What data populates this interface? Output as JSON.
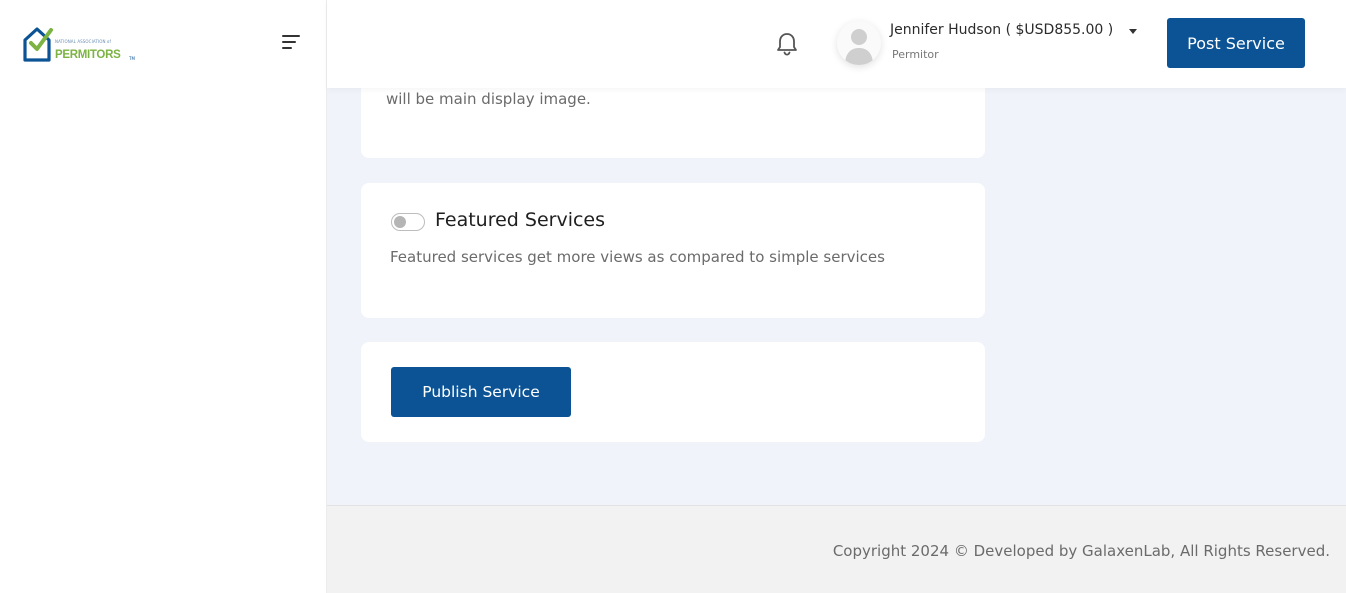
{
  "brand": {
    "logo_small_text": "NATIONAL ASSOCIATION of",
    "logo_main_text": "PERMITORS",
    "logo_tm": "TM",
    "colors": {
      "primary": "#0b5394",
      "accent": "#7cb342"
    }
  },
  "header": {
    "user_name": "Jennifer Hudson ( $USD855.00 )",
    "user_role": "Permitor",
    "post_button_label": "Post Service",
    "icons": [
      "menu-icon",
      "bell-icon",
      "avatar-icon",
      "caret-down-icon"
    ]
  },
  "cards": {
    "image_note": "will be main display image.",
    "featured": {
      "title": "Featured Services",
      "description": "Featured services get more views as compared to simple services",
      "toggle_on": false
    },
    "publish_button_label": "Publish Service"
  },
  "footer": {
    "copyright": "Copyright 2024 © Developed by GalaxenLab, All Rights Reserved."
  }
}
